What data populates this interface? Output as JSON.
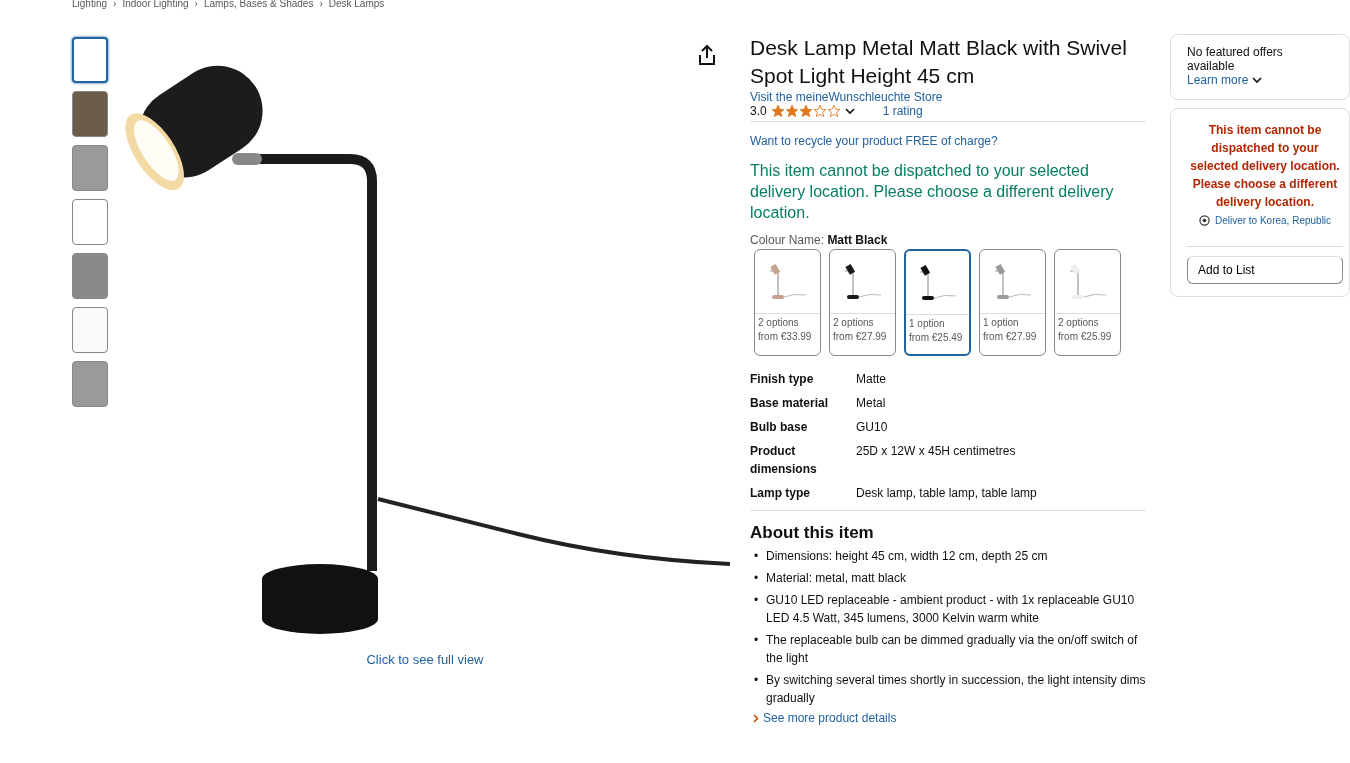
{
  "breadcrumb": {
    "separator": "›",
    "items": [
      "Lighting",
      "Indoor Lighting",
      "Lamps, Bases & Shades",
      "Desk Lamps"
    ]
  },
  "gallery": {
    "thumbnails": [
      {
        "selected": true
      },
      {
        "selected": false
      },
      {
        "selected": false
      },
      {
        "selected": false
      },
      {
        "selected": false
      },
      {
        "selected": false
      },
      {
        "selected": false
      }
    ],
    "caption": "Click to see full view"
  },
  "product": {
    "title": "Desk Lamp Metal Matt Black with Swivel Spot Light Height 45 cm",
    "store_link": "Visit the meineWunschleuchte Store",
    "rating": "3.0",
    "stars": 3,
    "rating_count": "1 rating",
    "recycle_link": "Want to recycle your product FREE of charge?",
    "dispatch_notice": "This item cannot be dispatched to your selected delivery location. Please choose a different delivery location.",
    "colour_label": "Colour Name:",
    "colour_value": "Matt Black",
    "variants": [
      {
        "options": "2 options",
        "price": "from €33.99",
        "color": "#c9a08e",
        "selected": false
      },
      {
        "options": "2 options",
        "price": "from €27.99",
        "color": "#1a1a1a",
        "selected": false
      },
      {
        "options": "1 option",
        "price": "from €25.49",
        "color": "#111111",
        "selected": true
      },
      {
        "options": "1 option",
        "price": "from €27.99",
        "color": "#9a9a9a",
        "selected": false
      },
      {
        "options": "2 options",
        "price": "from €25.99",
        "color": "#eeeeee",
        "selected": false
      }
    ],
    "specs": [
      {
        "label": "Finish type",
        "value": "Matte"
      },
      {
        "label": "Base material",
        "value": "Metal"
      },
      {
        "label": "Bulb base",
        "value": "GU10"
      },
      {
        "label": "Product dimensions",
        "value": "25D x 12W x 45H centimetres"
      },
      {
        "label": "Lamp type",
        "value": "Desk lamp, table lamp, table lamp"
      }
    ],
    "about_title": "About this item",
    "bullet_marker": "•",
    "bullets": [
      "Dimensions: height 45 cm, width 12 cm, depth 25 cm",
      "Material: metal, matt black",
      "GU10 LED replaceable - ambient product - with 1x replaceable GU10 LED 4.5 Watt, 345 lumens, 3000 Kelvin warm white",
      "The replaceable bulb can be dimmed gradually via the on/off switch of the light",
      "By switching several times shortly in succession, the light intensity dims gradually"
    ],
    "more_link": "See more product details"
  },
  "buybox": {
    "offers_text": "No featured offers available",
    "learn_more": "Learn more",
    "notice": "This item cannot be dispatched to your selected delivery location. Please choose a different delivery location.",
    "deliver_to": "Deliver to Korea, Republic",
    "add_to_list": "Add to List"
  }
}
